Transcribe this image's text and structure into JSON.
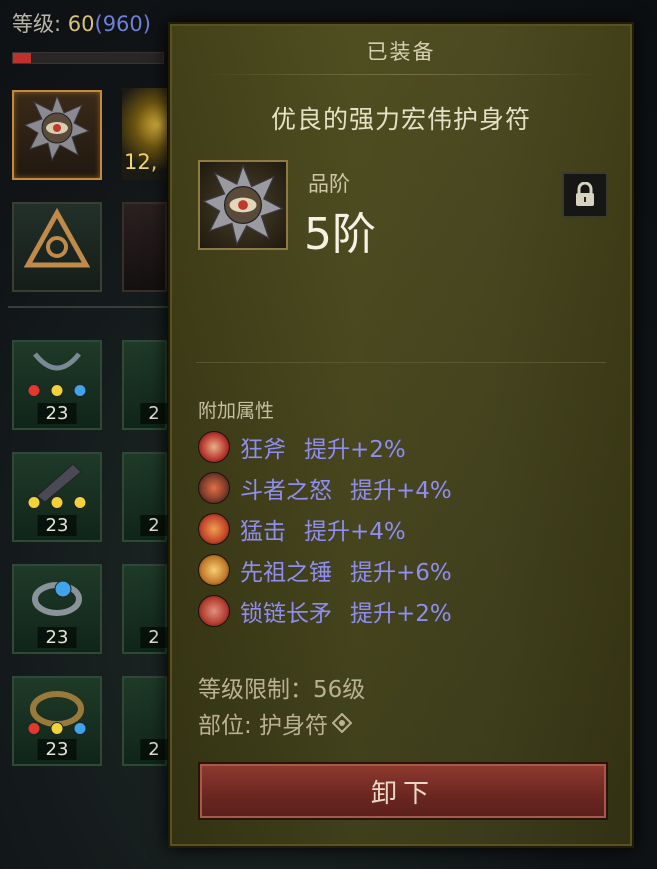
{
  "player": {
    "level_label": "等级:",
    "level": "60",
    "paragon": "(960)",
    "xp_progress": 0.12
  },
  "inventory": {
    "gold_amount": "12,",
    "slots": [
      {
        "name": "amulet",
        "level": ""
      },
      {
        "name": "ancient-symbol",
        "level": ""
      },
      {
        "name": "necklace",
        "level": "23"
      },
      {
        "name": "bracer",
        "level": "23"
      },
      {
        "name": "ring-blue",
        "level": "23"
      },
      {
        "name": "ring-gold",
        "level": "23"
      }
    ],
    "partial_levels": [
      "2",
      "2",
      "2",
      "2"
    ]
  },
  "tooltip": {
    "header": "已装备",
    "item_name": "优良的强力宏伟护身符",
    "tier_label": "品阶",
    "tier_value": "5阶",
    "attributes_header": "附加属性",
    "attributes": [
      {
        "skill": "狂斧",
        "bonus": "提升+2%",
        "color": "#b8352c"
      },
      {
        "skill": "斗者之怒",
        "bonus": "提升+4%",
        "color": "#7a3a2a"
      },
      {
        "skill": "猛击",
        "bonus": "提升+4%",
        "color": "#c2452a"
      },
      {
        "skill": "先祖之锤",
        "bonus": "提升+6%",
        "color": "#c27a2a"
      },
      {
        "skill": "锁链长矛",
        "bonus": "提升+2%",
        "color": "#b33d30"
      }
    ],
    "level_requirement": "等级限制：56级",
    "slot": "部位: 护身符",
    "unequip_label": "卸下"
  },
  "colors": {
    "attribute_text": "#8f8df2",
    "panel_bg": "#45451f",
    "button_red": "#7a2c24"
  }
}
